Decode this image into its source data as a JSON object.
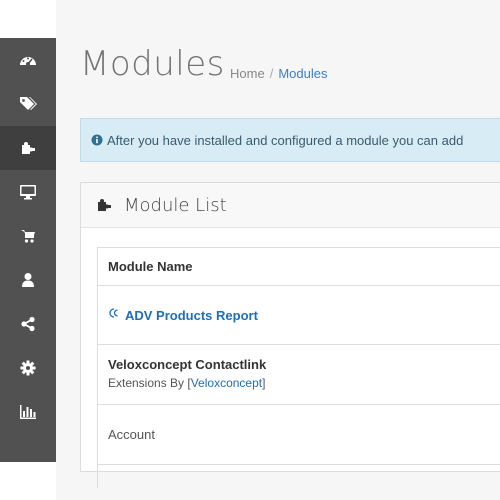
{
  "sidebar": {
    "items": [
      {
        "icon": "dashboard-icon",
        "active": false
      },
      {
        "icon": "tags-icon",
        "active": false
      },
      {
        "icon": "puzzle-icon",
        "active": true
      },
      {
        "icon": "desktop-icon",
        "active": false
      },
      {
        "icon": "shopping-cart-icon",
        "active": false
      },
      {
        "icon": "user-icon",
        "active": false
      },
      {
        "icon": "share-icon",
        "active": false
      },
      {
        "icon": "cog-icon",
        "active": false
      },
      {
        "icon": "bar-chart-icon",
        "active": false
      }
    ]
  },
  "header": {
    "title": "Modules",
    "breadcrumb": {
      "home": "Home",
      "separator": "/",
      "current": "Modules"
    }
  },
  "alert": {
    "icon": "info-circle-icon",
    "text": "After you have installed and configured a module you can add"
  },
  "panel": {
    "icon": "puzzle-icon",
    "title": "Module List",
    "table": {
      "header": "Module Name",
      "rows": [
        {
          "name": "ADV Products Report",
          "icon": "adv-logo-icon"
        },
        {
          "name": "Veloxconcept Contactlink",
          "sub_prefix": "Extensions By [",
          "sub_link": "Veloxconcept",
          "sub_suffix": "]"
        },
        {
          "name": "Account"
        }
      ]
    }
  },
  "colors": {
    "sidebar_bg": "#515151",
    "sidebar_active": "#3f3f3f",
    "link": "#1f6fb2",
    "alert_bg": "#d7ecf4"
  }
}
